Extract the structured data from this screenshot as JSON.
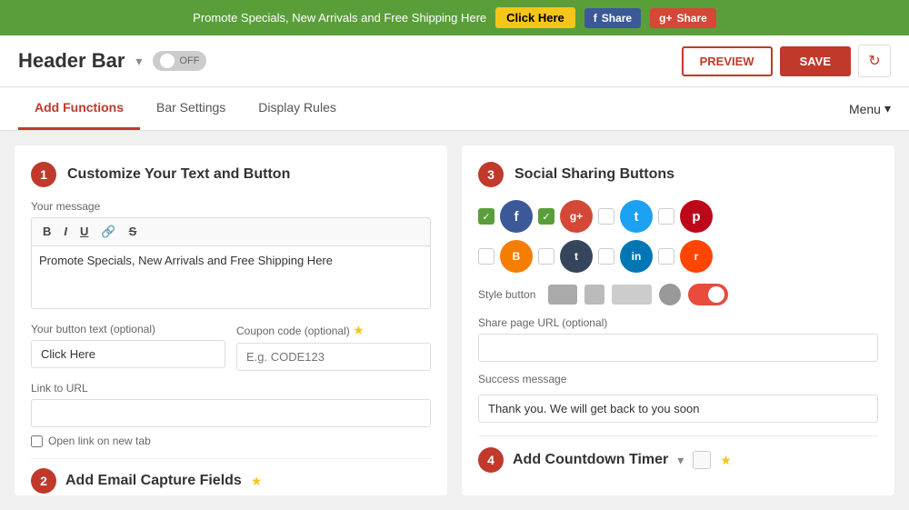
{
  "promo_bar": {
    "text": "Promote Specials, New Arrivals and Free Shipping Here",
    "click_here_label": "Click Here",
    "share_fb_label": "Share",
    "share_gp_label": "Share"
  },
  "header": {
    "title": "Header Bar",
    "toggle_label": "OFF",
    "preview_label": "PREVIEW",
    "save_label": "SAVE"
  },
  "tabs": {
    "add_functions": "Add Functions",
    "bar_settings": "Bar Settings",
    "display_rules": "Display Rules",
    "menu": "Menu"
  },
  "section1": {
    "num": "1",
    "title": "Customize Your Text and Button",
    "message_label": "Your message",
    "message_value": "Promote Specials, New Arrivals and Free Shipping Here",
    "button_text_label": "Your button text (optional)",
    "button_text_value": "Click Here",
    "coupon_label": "Coupon code (optional)",
    "coupon_placeholder": "E.g. CODE123",
    "link_label": "Link to URL",
    "link_value": "",
    "open_new_tab_label": "Open link on new tab"
  },
  "section2": {
    "num": "2",
    "title": "Add Email Capture Fields"
  },
  "section3": {
    "num": "3",
    "title": "Social Sharing Buttons",
    "style_label": "Style button",
    "share_url_label": "Share page URL (optional)",
    "share_url_value": "",
    "success_label": "Success message",
    "success_value": "Thank you. We will get back to you soon"
  },
  "section4": {
    "num": "4",
    "title": "Add Countdown Timer"
  },
  "toolbar": {
    "bold": "B",
    "italic": "I",
    "underline": "U"
  },
  "social_icons": [
    {
      "id": "fb",
      "letter": "f",
      "class": "si-fb",
      "checked": true
    },
    {
      "id": "gp",
      "letter": "g+",
      "class": "si-gp",
      "checked": true
    },
    {
      "id": "tw",
      "letter": "t",
      "class": "si-tw",
      "checked": false
    },
    {
      "id": "pi",
      "letter": "p",
      "class": "si-pi",
      "checked": false
    },
    {
      "id": "bl",
      "letter": "b",
      "class": "si-bl",
      "checked": false
    },
    {
      "id": "tu",
      "letter": "t",
      "class": "si-tu",
      "checked": false
    },
    {
      "id": "li",
      "letter": "in",
      "class": "si-li",
      "checked": false
    },
    {
      "id": "rd",
      "letter": "r",
      "class": "si-rd",
      "checked": false
    }
  ]
}
